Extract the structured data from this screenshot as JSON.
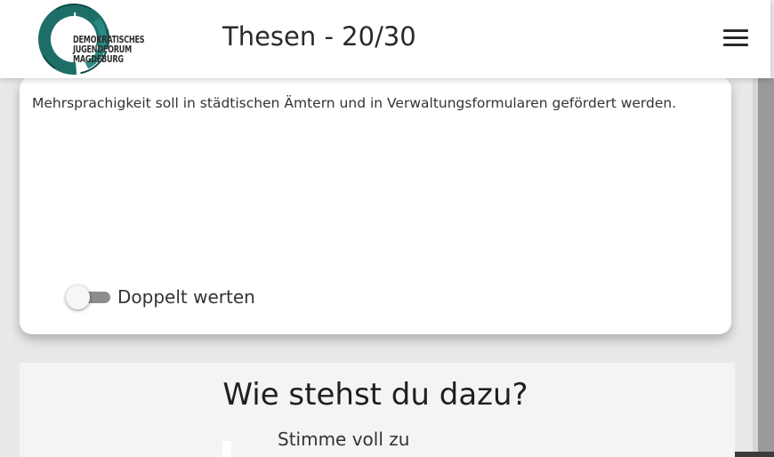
{
  "header": {
    "logo": {
      "icon": "circle-ring-logo-icon",
      "lines": [
        "DEMOKRATISCHES",
        "JUGENDFORUM",
        "MAGDEBURG"
      ],
      "ring_colors": [
        "#1e6e68",
        "#2a8a82",
        "#0f4d48"
      ]
    },
    "title": "Thesen - 20/30",
    "menu_icon": "hamburger-menu-icon"
  },
  "card": {
    "thesis_text": "Mehrsprachigkeit soll in städtischen Ämtern und in Verwaltungsformularen gefördert werden.",
    "toggle": {
      "label": "Doppelt werten",
      "checked": false
    }
  },
  "vote": {
    "question": "Wie stehst du dazu?",
    "options": [
      "Stimme voll zu"
    ]
  }
}
